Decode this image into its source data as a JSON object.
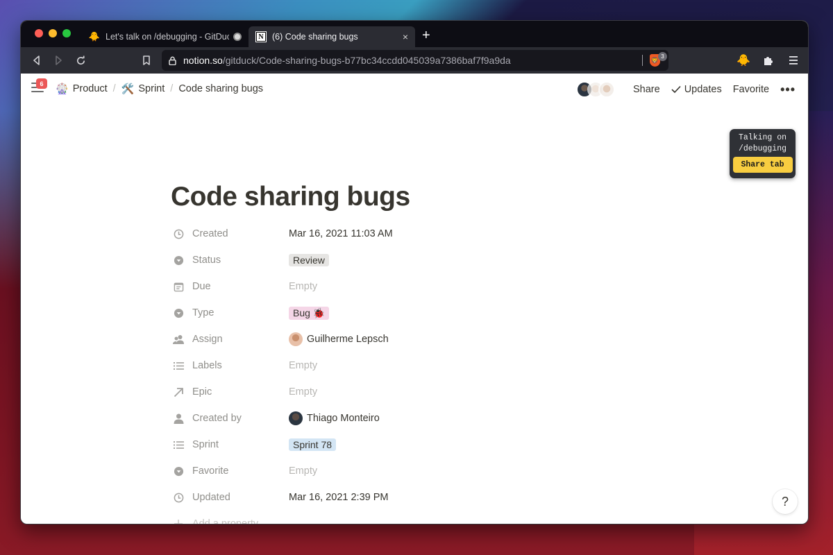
{
  "browser": {
    "tabs": [
      {
        "title": "Let's talk on /debugging - GitDuck",
        "icon": "duck-icon",
        "active": false,
        "audio": true
      },
      {
        "title": "(6) Code sharing bugs",
        "icon": "notion-icon",
        "active": true
      }
    ],
    "new_tab_label": "+",
    "close_tab_label": "×",
    "url": {
      "host": "notion.so",
      "path": "/gitduck/Code-sharing-bugs-b77bc34ccdd045039a7386baf7f9a9da"
    },
    "brave_shield_count": "3"
  },
  "topbar": {
    "notification_count": "6",
    "breadcrumb": [
      {
        "emoji": "🎡",
        "label": "Product"
      },
      {
        "emoji": "🛠️",
        "label": "Sprint"
      },
      {
        "emoji": "",
        "label": "Code sharing bugs"
      }
    ],
    "separator": "/",
    "share_label": "Share",
    "updates_label": "Updates",
    "favorite_label": "Favorite",
    "more_label": "•••"
  },
  "gitduck_widget": {
    "line1": "Talking on",
    "line2": "/debugging",
    "button_label": "Share tab"
  },
  "page": {
    "title": "Code sharing bugs",
    "properties": [
      {
        "name": "Created",
        "icon": "clock-icon",
        "value": "Mar 16, 2021 11:03 AM",
        "kind": "text"
      },
      {
        "name": "Status",
        "icon": "select-icon",
        "value": "Review",
        "kind": "tag-gray"
      },
      {
        "name": "Due",
        "icon": "calendar-icon",
        "value": "Empty",
        "kind": "empty"
      },
      {
        "name": "Type",
        "icon": "select-icon",
        "value": "Bug 🐞",
        "kind": "tag-pink"
      },
      {
        "name": "Assign",
        "icon": "people-icon",
        "value": "Guilherme Lepsch",
        "kind": "person"
      },
      {
        "name": "Labels",
        "icon": "list-icon",
        "value": "Empty",
        "kind": "empty"
      },
      {
        "name": "Epic",
        "icon": "relation-arrow-icon",
        "value": "Empty",
        "kind": "empty"
      },
      {
        "name": "Created by",
        "icon": "person-icon",
        "value": "Thiago Monteiro",
        "kind": "person"
      },
      {
        "name": "Sprint",
        "icon": "list-icon",
        "value": "Sprint 78",
        "kind": "tag-blue"
      },
      {
        "name": "Favorite",
        "icon": "select-icon",
        "value": "Empty",
        "kind": "empty"
      },
      {
        "name": "Updated",
        "icon": "clock-icon",
        "value": "Mar 16, 2021 2:39 PM",
        "kind": "text"
      }
    ],
    "add_property_label": "Add a property"
  },
  "help_label": "?"
}
